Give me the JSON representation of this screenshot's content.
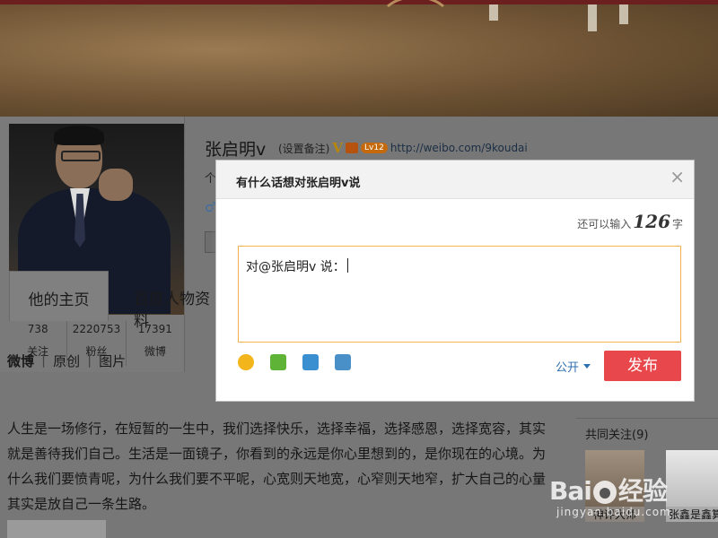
{
  "profile": {
    "name": "张启明v",
    "remark_label": "(设置备注)",
    "verified_badge": "V",
    "level_badge": "Lv12",
    "url": "http://weibo.com/9koudai",
    "bio_fragment": "个",
    "gender_icon": "♂",
    "stats": [
      {
        "value": "738",
        "label": "关注"
      },
      {
        "value": "2220753",
        "label": "粉丝"
      },
      {
        "value": "17391",
        "label": "微博"
      }
    ]
  },
  "tabs": [
    "他的主页",
    "百度人物资料"
  ],
  "subtabs": [
    "微博",
    "原创",
    "图片"
  ],
  "post": {
    "text": "人生是一场修行，在短暂的一生中，我们选择快乐，选择幸福，选择感恩，选择宽容，其实就是善待我们自己。生活是一面镜子，你看到的永远是你心里想到的，是你现在的心境。为什么我们要愤青呢，为什么我们要不平呢，心宽则天地宽，心窄则天地窄，扩大自己的心量其实是放自己一条生路。"
  },
  "sidebar": {
    "common_follow_title": "共同关注(9)",
    "people": [
      "神评大师",
      "张鑫是鑫算"
    ]
  },
  "dialog": {
    "title": "有什么话想对张启明v说",
    "close": "×",
    "counter_prefix": "还可以输入",
    "counter_value": "126",
    "counter_suffix": "字",
    "textarea_value": "对@张启明v 说：",
    "visibility": "公开",
    "publish_label": "发布"
  },
  "watermark": {
    "logo_left": "Bai",
    "logo_right": "经验",
    "url": "jingyan.baidu.com"
  },
  "colors": {
    "publish": "#e8484c",
    "link": "#2e6fb0",
    "textarea_border": "#f3b34f"
  }
}
